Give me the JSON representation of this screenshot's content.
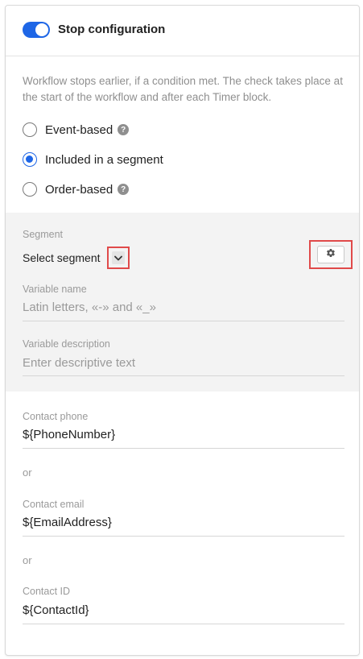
{
  "header": {
    "title": "Stop configuration",
    "toggle_on": true,
    "toggle_color": "#1e66e6"
  },
  "description": "Workflow stops earlier, if a condition met. The check takes place at the start of the workflow and after each Timer block.",
  "options": [
    {
      "label": "Event-based",
      "checked": false,
      "help": "?"
    },
    {
      "label": "Included in a segment",
      "checked": true
    },
    {
      "label": "Order-based",
      "checked": false,
      "help": "?"
    }
  ],
  "segment": {
    "label": "Segment",
    "value": "Select segment",
    "dropdown_icon": "chevron-down-icon",
    "settings_icon": "gear-icon"
  },
  "variable_name": {
    "label": "Variable name",
    "placeholder": "Latin letters, «-» and «_»"
  },
  "variable_description": {
    "label": "Variable description",
    "placeholder": "Enter descriptive text"
  },
  "contact_phone": {
    "label": "Contact phone",
    "value": "${PhoneNumber}"
  },
  "or_1": "or",
  "contact_email": {
    "label": "Contact email",
    "value": "${EmailAddress}"
  },
  "or_2": "or",
  "contact_id": {
    "label": "Contact ID",
    "value": "${ContactId}"
  },
  "colors": {
    "accent": "#1e66e6",
    "highlight": "#e04a4a",
    "section_bg": "#f3f3f3"
  }
}
